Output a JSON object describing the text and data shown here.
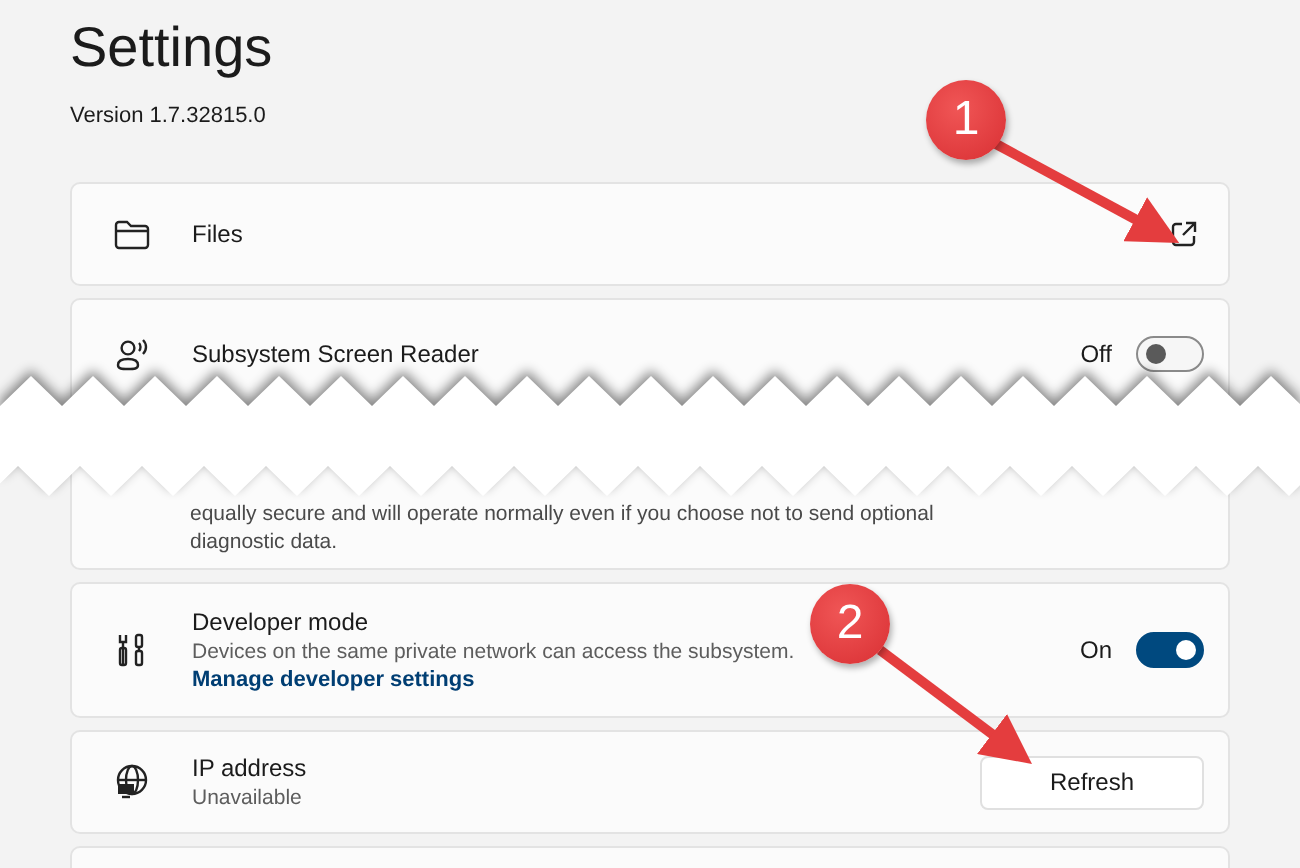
{
  "title": "Settings",
  "version": "Version 1.7.32815.0",
  "cards": [
    {
      "kind": "link",
      "label": "Files"
    },
    {
      "kind": "toggle",
      "label": "Subsystem Screen Reader",
      "state_label": "Off",
      "on": false,
      "torn": true,
      "note": "equally secure and will operate normally even if you choose not to send optional diagnostic data."
    },
    {
      "kind": "toggle",
      "label": "Developer mode",
      "description": "Devices on the same private network can access the subsystem.",
      "link": "Manage developer settings",
      "state_label": "On",
      "on": true
    },
    {
      "kind": "button",
      "label": "IP address",
      "description": "Unavailable",
      "button": "Refresh"
    }
  ],
  "annotations": [
    {
      "label": "1"
    },
    {
      "label": "2"
    }
  ]
}
